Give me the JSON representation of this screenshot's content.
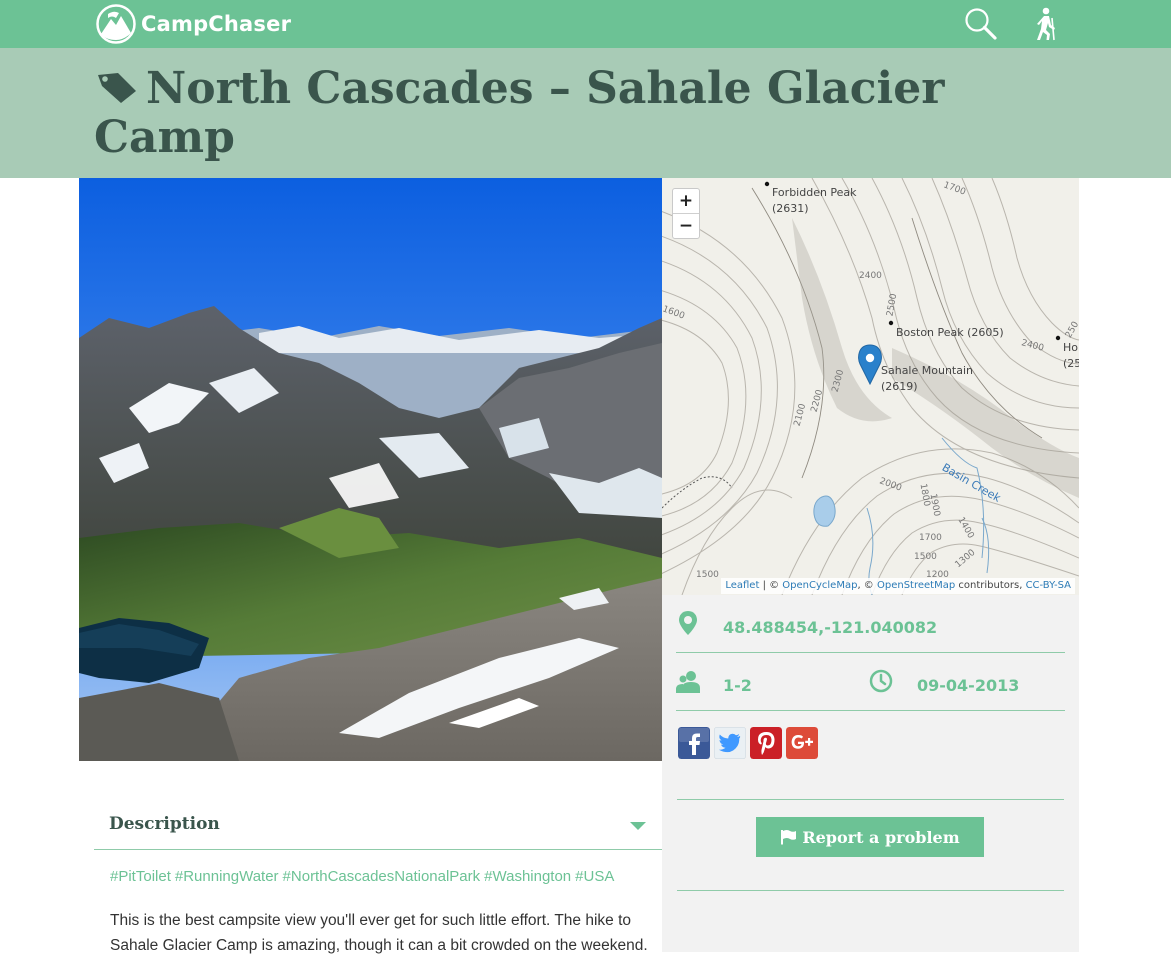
{
  "header": {
    "brand": "CampChaser",
    "icons": {
      "search": "search-icon",
      "hiker": "hiker-icon",
      "logo": "mountain-logo-icon"
    },
    "accent_color": "#6cc295"
  },
  "page": {
    "title": "North Cascades – Sahale Glacier Camp",
    "title_icon": "tag-icon",
    "title_color": "#3a554c",
    "band_color": "#a8cbb6"
  },
  "map": {
    "zoom_in": "+",
    "zoom_out": "−",
    "labels": {
      "forbidden_peak": "Forbidden Peak",
      "forbidden_elev": "(2631)",
      "boston_peak": "Boston Peak (2605)",
      "sahale_mountain": "Sahale Mountain",
      "sahale_elev": "(2619)",
      "ho": "Ho",
      "ho_elev": "(25",
      "basin_creek": "Basin Creek",
      "c1700a": "1700",
      "c2400a": "2400",
      "c2500a": "2500",
      "c2400b": "2400",
      "c250": "250",
      "c1600": "1600",
      "c2100": "2100",
      "c2200": "2200",
      "c2300": "2300",
      "c2000": "2000",
      "c1800": "1800",
      "c1900": "1900",
      "c1700b": "1700",
      "c1500a": "1500",
      "c1400": "1400",
      "c1300": "1300",
      "c1200": "1200",
      "c1500b": "1500"
    },
    "attribution": {
      "leaflet": "Leaflet",
      "sep1": " | © ",
      "opencyclemap": "OpenCycleMap",
      "sep2": ", © ",
      "openstreetmap": "OpenStreetMap",
      "contributors": " contributors, ",
      "license": "CC-BY-SA"
    }
  },
  "info": {
    "coordinates": "48.488454,-121.040082",
    "capacity": "1-2",
    "date": "09-04-2013",
    "icons": {
      "location": "map-pin-icon",
      "people": "people-icon",
      "clock": "clock-icon"
    }
  },
  "social": [
    {
      "name": "facebook",
      "color": "#3b5998"
    },
    {
      "name": "twitter",
      "color": "#4099ff"
    },
    {
      "name": "pinterest",
      "color": "#cb2027"
    },
    {
      "name": "google-plus",
      "color": "#dd4b39"
    }
  ],
  "report": {
    "label": "Report a problem",
    "icon": "flag-icon"
  },
  "description": {
    "heading": "Description",
    "tags": [
      "#PitToilet",
      "#RunningWater",
      "#NorthCascadesNationalPark",
      "#Washington",
      "#USA"
    ],
    "text": "This is the best campsite view you'll ever get for such little effort. The hike to Sahale Glacier Camp is amazing, though it can a bit crowded on the weekend."
  }
}
